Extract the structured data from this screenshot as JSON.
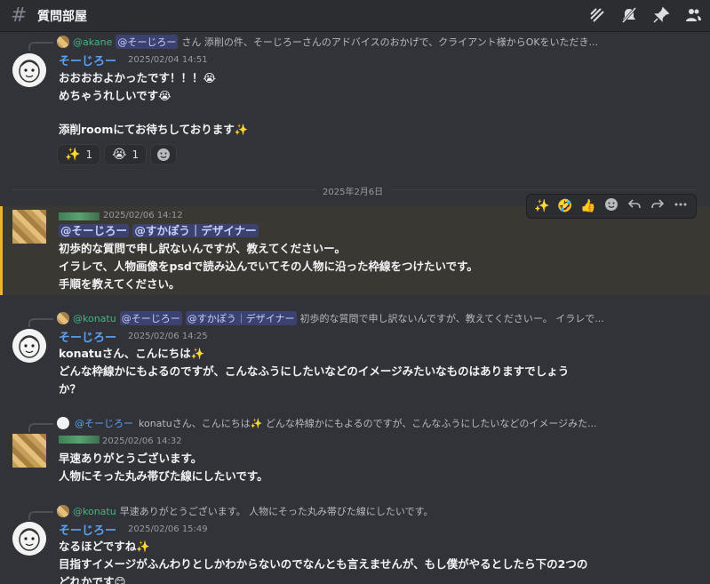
{
  "channel": {
    "name": "質問部屋",
    "icon": "hash-icon"
  },
  "header_icons": [
    "threads-icon",
    "mute-icon",
    "pin-icon",
    "members-icon"
  ],
  "date_divider": "2025年2月6日",
  "messages": [
    {
      "reply": {
        "author": "@akane",
        "mention": "@そーじろー",
        "text": "さん 添削の件、そーじろーさんのアドバイスのおかげで、クライアント様からOKをいただき..."
      },
      "author": "そーじろー",
      "timestamp": "2025/02/04 14:51",
      "lines": [
        "おおおおよかったです！！！😭",
        "めちゃうれしいです😭",
        "",
        "添削roomにてお待ちしております✨"
      ],
      "reactions": [
        {
          "emoji": "✨",
          "count": "1"
        },
        {
          "emoji": "😭",
          "count": "1"
        }
      ]
    },
    {
      "author": "",
      "timestamp": "2025/02/06 14:12",
      "mentions": [
        "@そーじろー",
        "@すかぽう｜デザイナー"
      ],
      "lines": [
        "初歩的な質問で申し訳ないんですが、教えてくださいー。",
        "イラレで、人物画像をpsdで読み込んでいてその人物に沿った枠線をつけたいです。",
        "手順を教えてください。"
      ],
      "toolbar": [
        "✨",
        "🤣",
        "👍",
        "add-reaction-icon",
        "reply-icon",
        "forward-icon",
        "more-icon"
      ]
    },
    {
      "reply": {
        "author": "@konatu",
        "mentions": [
          "@そーじろー",
          "@すかぽう｜デザイナー"
        ],
        "text": "初歩的な質問で申し訳ないんですが、教えてくださいー。 イラレで..."
      },
      "author": "そーじろー",
      "timestamp": "2025/02/06 14:25",
      "lines": [
        "konatuさん、こんにちは✨",
        "どんな枠線かにもよるのですが、こんなふうにしたいなどのイメージみたいなものはありますでしょう",
        "か？"
      ]
    },
    {
      "reply": {
        "author": "@そーじろー",
        "text": "konatuさん、こんにちは✨ どんな枠線かにもよるのですが、こんなふうにしたいなどのイメージみた..."
      },
      "author": "",
      "timestamp": "2025/02/06 14:32",
      "lines": [
        "早速ありがとうございます。",
        "人物にそった丸み帯びた線にしたいです。"
      ]
    },
    {
      "reply": {
        "author": "@konatu",
        "text": "早速ありがとうございます。 人物にそった丸み帯びた線にしたいです。"
      },
      "author": "そーじろー",
      "timestamp": "2025/02/06 15:49",
      "lines": [
        "なるほどですね✨",
        "目指すイメージがふんわりとしかわからないのでなんとも言えませんが、もし僕がやるとしたら下の2つの",
        "どれかです😊"
      ]
    }
  ]
}
